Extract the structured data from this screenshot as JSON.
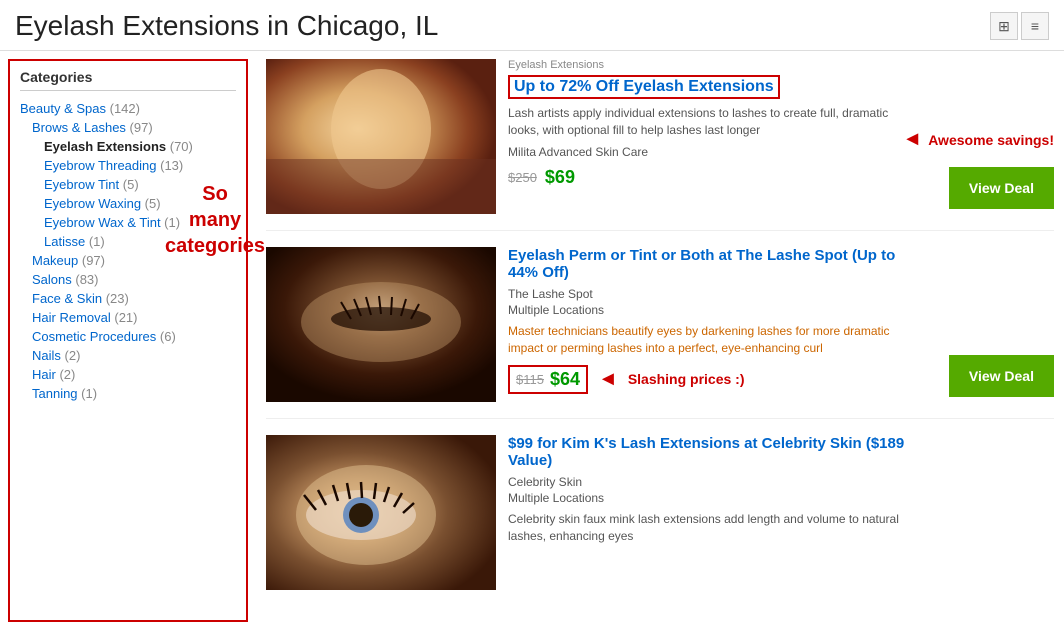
{
  "header": {
    "title": "Eyelash Extensions in Chicago, IL",
    "view_grid_label": "⊞",
    "view_list_label": "≡"
  },
  "sidebar": {
    "title": "Categories",
    "items": [
      {
        "label": "Beauty & Spas",
        "count": "(142)",
        "level": "l1",
        "active": false
      },
      {
        "label": "Brows & Lashes",
        "count": "(97)",
        "level": "l2",
        "active": false
      },
      {
        "label": "Eyelash Extensions",
        "count": "(70)",
        "level": "l3",
        "active": true
      },
      {
        "label": "Eyebrow Threading",
        "count": "(13)",
        "level": "l3",
        "active": false
      },
      {
        "label": "Eyebrow Tint",
        "count": "(5)",
        "level": "l3",
        "active": false
      },
      {
        "label": "Eyebrow Waxing",
        "count": "(5)",
        "level": "l3",
        "active": false
      },
      {
        "label": "Eyebrow Wax & Tint",
        "count": "(1)",
        "level": "l3",
        "active": false
      },
      {
        "label": "Latisse",
        "count": "(1)",
        "level": "l3",
        "active": false
      },
      {
        "label": "Makeup",
        "count": "(97)",
        "level": "l2",
        "active": false
      },
      {
        "label": "Salons",
        "count": "(83)",
        "level": "l2",
        "active": false
      },
      {
        "label": "Face & Skin",
        "count": "(23)",
        "level": "l2",
        "active": false
      },
      {
        "label": "Hair Removal",
        "count": "(21)",
        "level": "l2",
        "active": false
      },
      {
        "label": "Cosmetic Procedures",
        "count": "(6)",
        "level": "l2",
        "active": false
      },
      {
        "label": "Nails",
        "count": "(2)",
        "level": "l2",
        "active": false
      },
      {
        "label": "Hair",
        "count": "(2)",
        "level": "l2",
        "active": false
      },
      {
        "label": "Tanning",
        "count": "(1)",
        "level": "l2",
        "active": false
      }
    ],
    "annotation": "So\nmany\ncategories"
  },
  "deals": [
    {
      "id": "deal-1",
      "category": "Eyelash Extensions",
      "title": "Up to 72% Off Eyelash Extensions",
      "title_boxed": true,
      "description": "Lash artists apply individual extensions to lashes to create full, dramatic looks, with optional fill to help lashes last longer",
      "merchant": "Milita Advanced Skin Care",
      "location": null,
      "price_original": "$250",
      "price_sale": "$69",
      "view_deal_label": "View Deal",
      "annotation": "Awesome savings!",
      "annotation_type": "awesome"
    },
    {
      "id": "deal-2",
      "category": null,
      "title": "Eyelash Perm or Tint or Both at The Lashe Spot (Up to 44% Off)",
      "title_boxed": false,
      "description": "Master technicians beautify eyes by darkening lashes for more dramatic impact or perming lashes into a perfect, eye-enhancing curl",
      "merchant": "The Lashe Spot",
      "location": "Multiple Locations",
      "price_original": "$115",
      "price_sale": "$64",
      "view_deal_label": "View Deal",
      "annotation": "Slashing prices :)",
      "annotation_type": "slashing"
    },
    {
      "id": "deal-3",
      "category": null,
      "title": "$99 for Kim K's Lash Extensions at Celebrity Skin ($189 Value)",
      "title_boxed": false,
      "description": "Celebrity skin faux mink lash extensions add length and volume to natural lashes, enhancing eyes",
      "merchant": "Celebrity Skin",
      "location": "Multiple Locations",
      "price_original": null,
      "price_sale": null,
      "view_deal_label": null,
      "annotation": null,
      "annotation_type": null
    }
  ]
}
